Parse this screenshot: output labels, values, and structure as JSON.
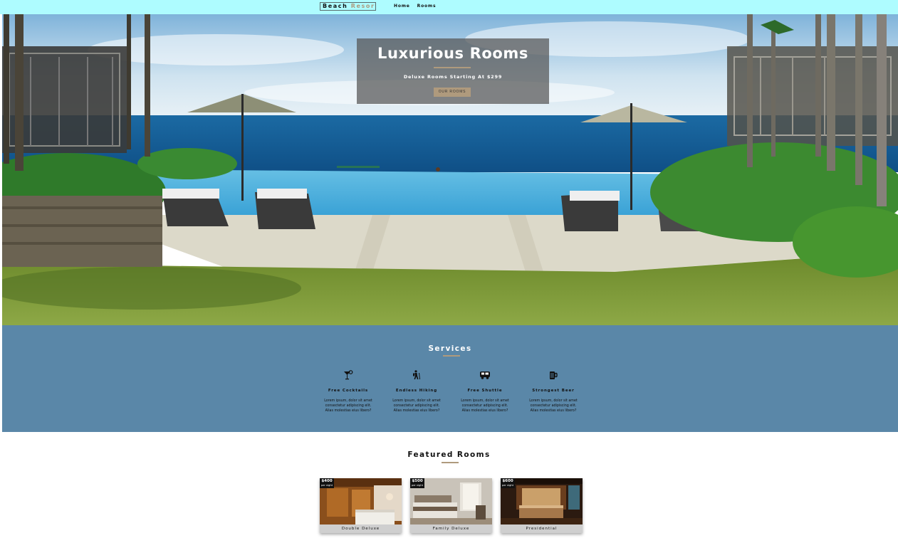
{
  "navbar": {
    "logo_part1": "Beach ",
    "logo_part2": "Resort",
    "links": [
      "Home",
      "Rooms"
    ]
  },
  "hero": {
    "title": "Luxurious Rooms",
    "subtitle": "Deluxe Rooms Starting At $299",
    "button": "OUR ROOMS"
  },
  "services": {
    "title": "Services",
    "items": [
      {
        "icon": "cocktail-icon",
        "name": "Free Cocktails",
        "desc": "Lorem ipsum, dolor sit amet consectetur adipiscing elit. Alias molestias eius libero?"
      },
      {
        "icon": "hiking-icon",
        "name": "Endless Hiking",
        "desc": "Lorem ipsum, dolor sit amet consectetur adipiscing elit. Alias molestias eius libero?"
      },
      {
        "icon": "shuttle-icon",
        "name": "Free Shuttle",
        "desc": "Lorem ipsum, dolor sit amet consectetur adipiscing elit. Alias molestias eius libero?"
      },
      {
        "icon": "beer-icon",
        "name": "Strongest Beer",
        "desc": "Lorem ipsum, dolor sit amet consectetur adipiscing elit. Alias molestias eius libero?"
      }
    ]
  },
  "featured": {
    "title": "Featured Rooms",
    "rooms": [
      {
        "price": "$400",
        "per": "per night",
        "name": "Double Deluxe"
      },
      {
        "price": "$500",
        "per": "per night",
        "name": "Family Deluxe"
      },
      {
        "price": "$600",
        "per": "per night",
        "name": "Presidential"
      }
    ]
  },
  "colors": {
    "navbar": "#aefcff",
    "accent": "#af9a7d",
    "services_bg": "#5a87a8",
    "banner_bg": "rgba(85,85,85,0.72)"
  }
}
